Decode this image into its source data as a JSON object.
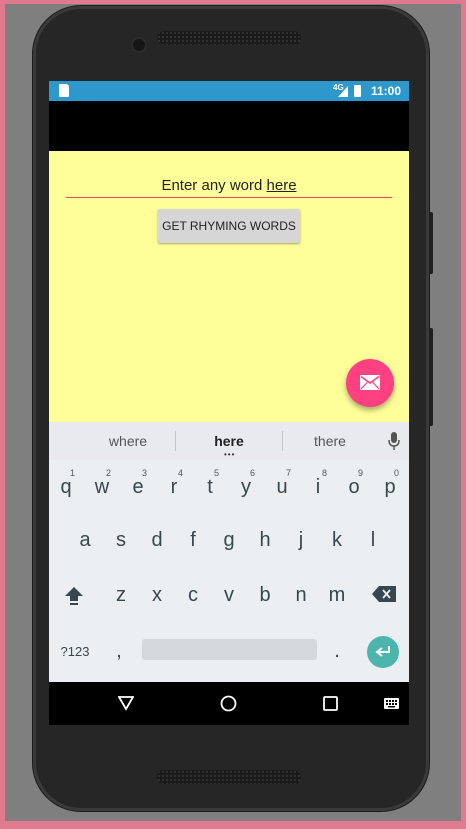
{
  "status_bar": {
    "network": "4G",
    "time": "11:00"
  },
  "content": {
    "input_text": "Enter any word ",
    "input_underlined": "here",
    "button_label": "GET RHYMING WORDS"
  },
  "keyboard": {
    "suggestions": [
      "where",
      "here",
      "there"
    ],
    "row1": [
      "q",
      "w",
      "e",
      "r",
      "t",
      "y",
      "u",
      "i",
      "o",
      "p"
    ],
    "row1_hints": [
      "1",
      "2",
      "3",
      "4",
      "5",
      "6",
      "7",
      "8",
      "9",
      "0"
    ],
    "row2": [
      "a",
      "s",
      "d",
      "f",
      "g",
      "h",
      "j",
      "k",
      "l"
    ],
    "row3": [
      "z",
      "x",
      "c",
      "v",
      "b",
      "n",
      "m"
    ],
    "symbols_key": "?123",
    "comma_key": ",",
    "period_key": "."
  },
  "icons": {
    "fab": "email-icon",
    "mic": "microphone-icon",
    "shift": "shift-icon",
    "backspace": "backspace-icon",
    "enter": "enter-icon",
    "nav_back": "back-triangle-icon",
    "nav_home": "home-circle-icon",
    "nav_recents": "recents-square-icon",
    "nav_keyboard": "keyboard-icon"
  },
  "colors": {
    "status_bar": "#2e97cb",
    "content_bg": "#ffff99",
    "fab": "#ff4081",
    "input_underline": "#e24a6a",
    "enter_key": "#4db6ac"
  }
}
